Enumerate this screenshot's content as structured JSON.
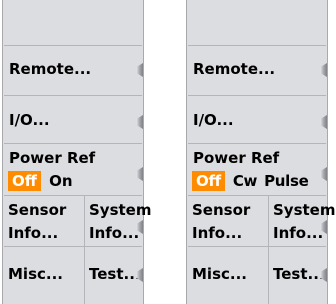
{
  "panels": [
    {
      "remote_label": "Remote...",
      "io_label": "I/O...",
      "power_ref": {
        "label": "Power Ref",
        "options": [
          "Off",
          "On"
        ],
        "selected": "Off"
      },
      "sensor_info": [
        "Sensor",
        "Info..."
      ],
      "system_info": [
        "System",
        "Info..."
      ],
      "misc_label": "Misc...",
      "test_label": "Test..."
    },
    {
      "remote_label": "Remote...",
      "io_label": "I/O...",
      "power_ref": {
        "label": "Power Ref",
        "options": [
          "Off",
          "Cw",
          "Pulse"
        ],
        "selected": "Off"
      },
      "sensor_info": [
        "Sensor",
        "Info..."
      ],
      "system_info": [
        "System",
        "Info..."
      ],
      "misc_label": "Misc...",
      "test_label": "Test..."
    }
  ],
  "colors": {
    "panel_bg": "#dcdde1",
    "selected_bg": "#ff8c00",
    "selected_fg": "#ffffff"
  },
  "icons": {
    "softkey_notch": "softkey-notch-icon"
  }
}
